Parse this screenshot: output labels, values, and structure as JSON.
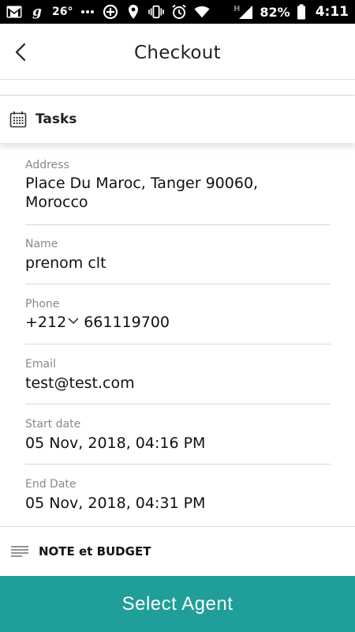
{
  "status_bar": {
    "temperature": "26°",
    "battery_percent": "82%",
    "time": "4:11",
    "network_letter": "H",
    "icons": [
      "gmail-icon",
      "g-app-icon",
      "more-dots-icon",
      "add-circle-icon",
      "location-pin-icon",
      "vibrate-icon",
      "alarm-icon",
      "wifi-icon",
      "signal-icon",
      "battery-icon"
    ]
  },
  "header": {
    "title": "Checkout",
    "back_icon": "chevron-left-icon"
  },
  "tasks": {
    "label": "Tasks",
    "icon": "calendar-grid-icon"
  },
  "fields": {
    "address": {
      "label": "Address",
      "value_line1": "Place Du Maroc, Tanger 90060,",
      "value_line2": "Morocco"
    },
    "name": {
      "label": "Name",
      "value": "prenom clt"
    },
    "phone": {
      "label": "Phone",
      "code": "+212",
      "number": "661119700"
    },
    "email": {
      "label": "Email",
      "value": "test@test.com"
    },
    "start_date": {
      "label": "Start date",
      "value": "05 Nov, 2018, 04:16 PM"
    },
    "end_date": {
      "label": "End Date",
      "value": "05 Nov, 2018, 04:31 PM"
    }
  },
  "note": {
    "label": "NOTE et BUDGET",
    "icon": "notes-lines-icon"
  },
  "action": {
    "select_agent_label": "Select Agent",
    "accent_color": "#1f9e9a"
  }
}
